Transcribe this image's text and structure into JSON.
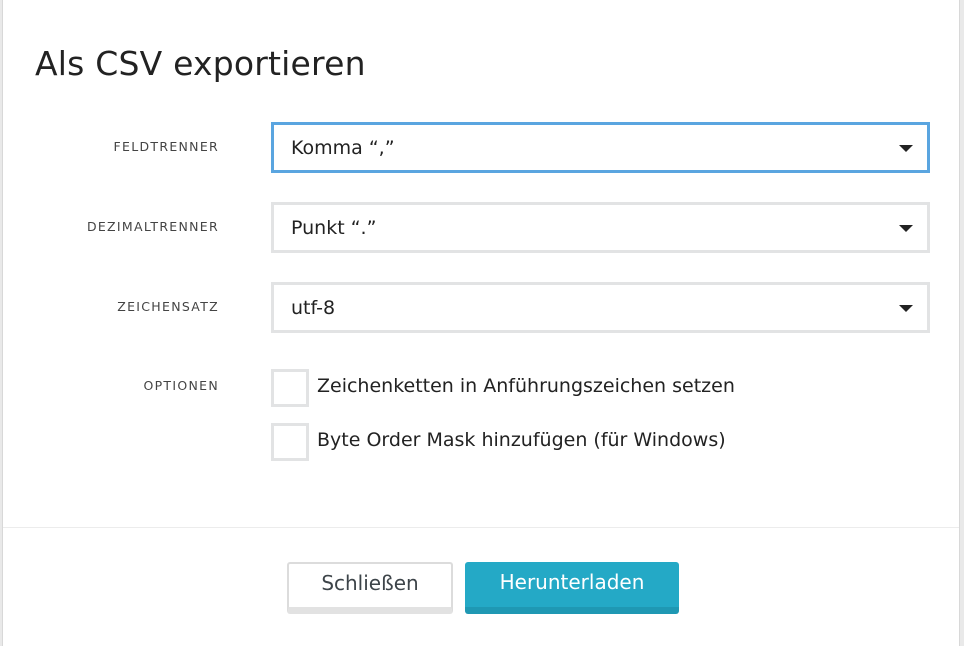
{
  "dialog": {
    "title": "Als CSV exportieren",
    "fields": [
      {
        "label": "FELDTRENNER",
        "value": "Komma “,”",
        "focused": true
      },
      {
        "label": "DEZIMALTRENNER",
        "value": "Punkt “.”"
      },
      {
        "label": "ZEICHENSATZ",
        "value": "utf-8"
      }
    ],
    "options": {
      "label": "OPTIONEN",
      "items": [
        {
          "label": "Zeichenketten in Anführungszeichen setzen",
          "checked": false
        },
        {
          "label": "Byte Order Mask hinzufügen (für Windows)",
          "checked": false
        }
      ]
    },
    "buttons": {
      "close": "Schließen",
      "download": "Herunterladen"
    },
    "colors": {
      "primary": "#24a9c6",
      "focus": "#5aa5e0"
    }
  }
}
